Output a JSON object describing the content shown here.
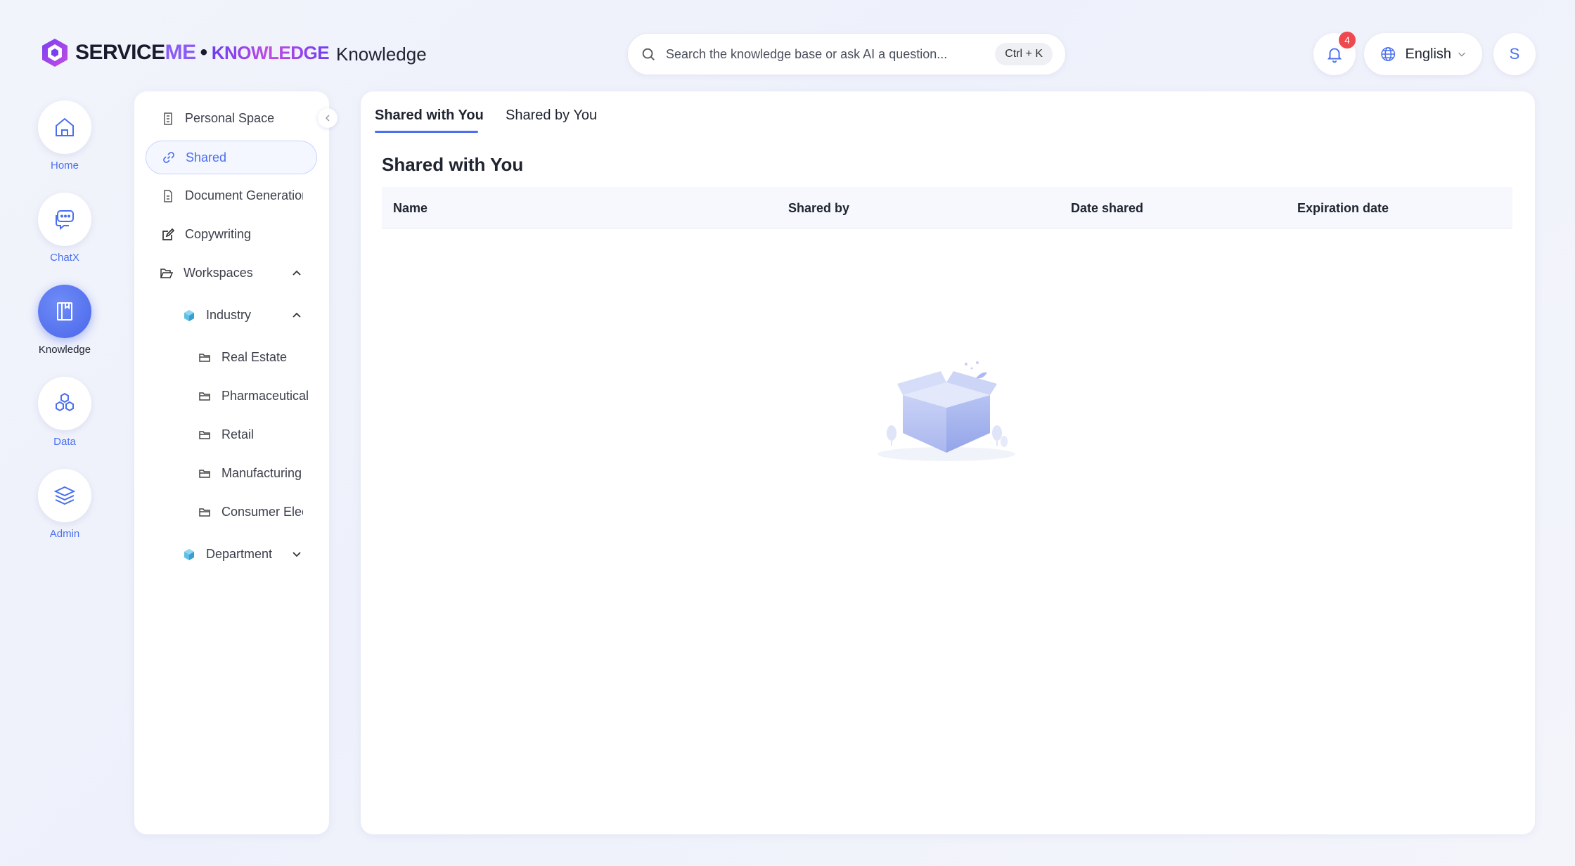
{
  "header": {
    "logo": {
      "part1": "SERVICE",
      "part2": "ME",
      "separator": "•",
      "part3": "KNOWLEDGE"
    },
    "app_title": "Knowledge",
    "search": {
      "placeholder": "Search the knowledge base or ask AI a question...",
      "shortcut": "Ctrl + K"
    },
    "notifications": {
      "count": "4"
    },
    "language": {
      "label": "English"
    },
    "avatar": {
      "initial": "S"
    }
  },
  "rail": {
    "items": [
      {
        "label": "Home",
        "icon": "home-icon"
      },
      {
        "label": "ChatX",
        "icon": "chat-icon"
      },
      {
        "label": "Knowledge",
        "icon": "book-icon",
        "active": true
      },
      {
        "label": "Data",
        "icon": "hexagons-icon"
      },
      {
        "label": "Admin",
        "icon": "layers-icon"
      }
    ]
  },
  "sidenav": {
    "items": [
      {
        "label": "Personal Space",
        "icon": "document-icon"
      },
      {
        "label": "Shared",
        "icon": "link-icon",
        "selected": true
      },
      {
        "label": "Document Generation",
        "icon": "file-icon"
      },
      {
        "label": "Copywriting",
        "icon": "edit-icon"
      },
      {
        "label": "Workspaces",
        "icon": "folder-open-icon",
        "expanded": true
      }
    ],
    "workspaces": [
      {
        "label": "Industry",
        "icon": "cube-icon",
        "expanded": true,
        "children": [
          "Real Estate",
          "Pharmaceutical",
          "Retail",
          "Manufacturing",
          "Consumer Electronics"
        ]
      },
      {
        "label": "Department",
        "icon": "cube-icon",
        "expanded": false
      }
    ]
  },
  "main": {
    "tabs": [
      {
        "label": "Shared with You",
        "active": true
      },
      {
        "label": "Shared by You",
        "active": false
      }
    ],
    "section_title": "Shared with You",
    "table": {
      "columns": [
        "Name",
        "Shared by",
        "Date shared",
        "Expiration date"
      ],
      "rows": []
    }
  },
  "colors": {
    "accent": "#4a6ff0",
    "badge": "#f0484f",
    "brand_purple": "#8a5cf6"
  }
}
